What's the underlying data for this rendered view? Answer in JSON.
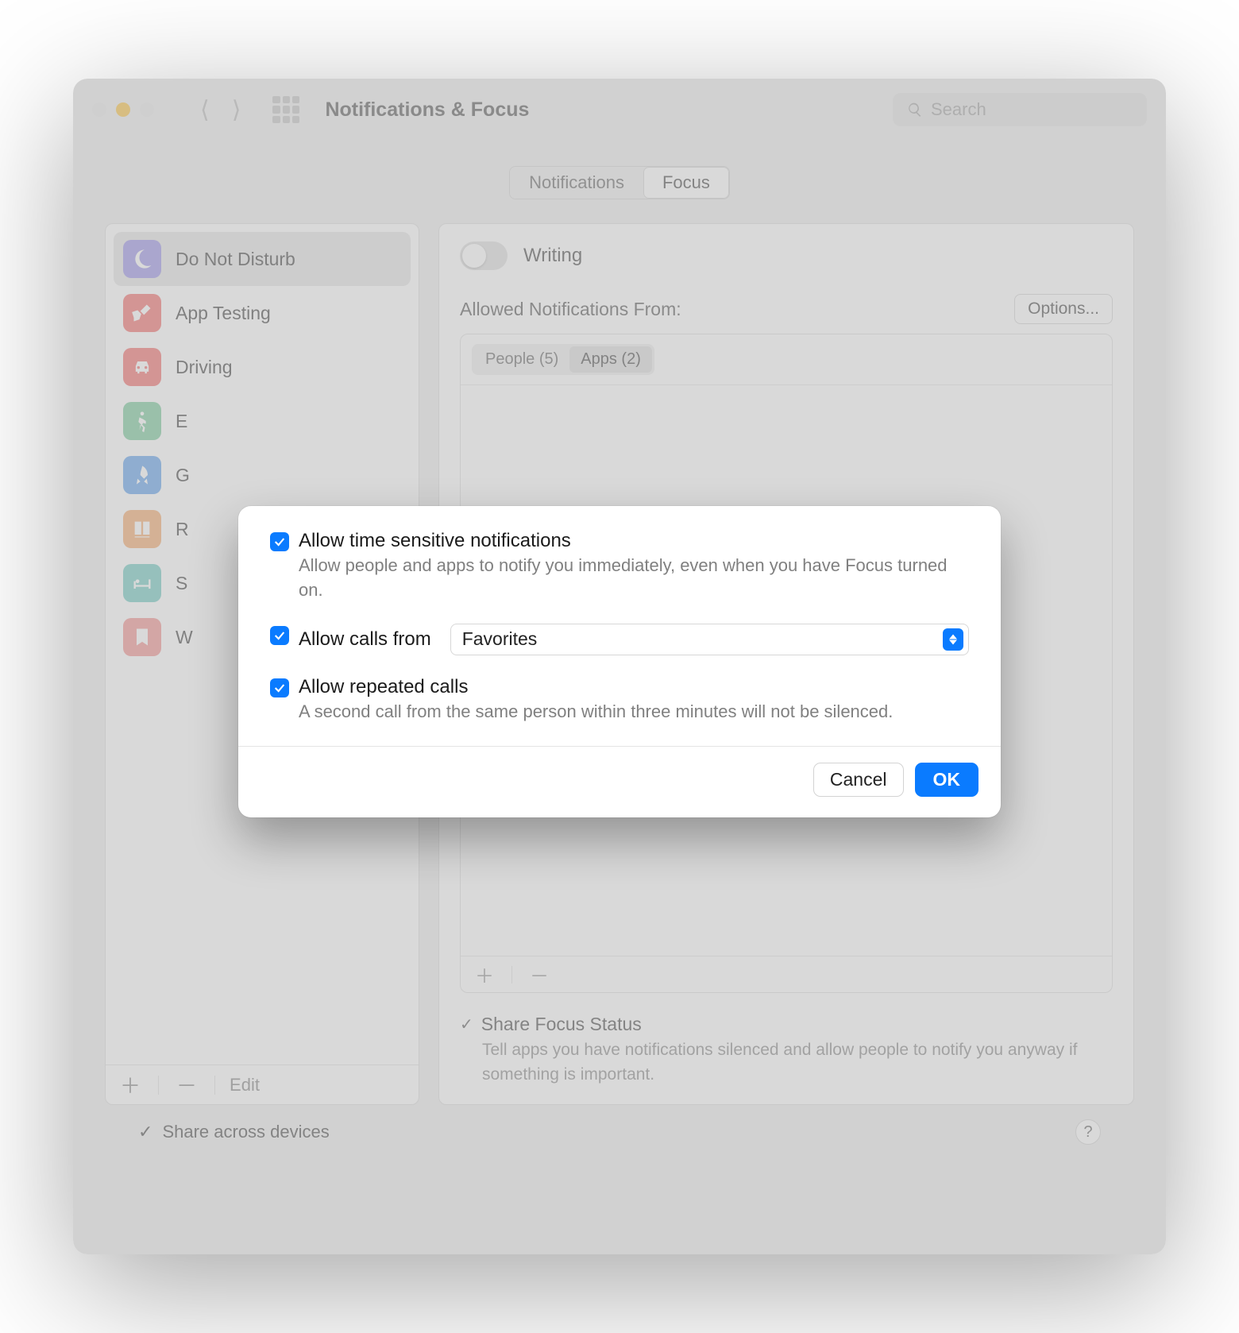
{
  "window": {
    "title": "Notifications & Focus",
    "search_placeholder": "Search"
  },
  "tabs": {
    "notifications": "Notifications",
    "focus": "Focus"
  },
  "sidebar": {
    "items": [
      {
        "label": "Do Not Disturb",
        "color": "#8f86e5",
        "icon": "moon"
      },
      {
        "label": "App Testing",
        "color": "#f05e5b",
        "icon": "tools"
      },
      {
        "label": "Driving",
        "color": "#f05e5b",
        "icon": "car"
      },
      {
        "label": "E",
        "color": "#6ac48f",
        "icon": "running"
      },
      {
        "label": "G",
        "color": "#4f97e9",
        "icon": "rocket"
      },
      {
        "label": "R",
        "color": "#f3a05e",
        "icon": "book"
      },
      {
        "label": "S",
        "color": "#61c4bb",
        "icon": "bed"
      },
      {
        "label": "W",
        "color": "#f18784",
        "icon": "bookmark"
      }
    ],
    "edit": "Edit"
  },
  "main": {
    "focus_name": "Writing",
    "allowed_label": "Allowed Notifications From:",
    "options_btn": "Options...",
    "sub_tabs": {
      "people": "People (5)",
      "apps": "Apps (2)"
    },
    "share_focus": {
      "title": "Share Focus Status",
      "desc": "Tell apps you have notifications silenced and allow people to notify you anyway if something is important."
    }
  },
  "bottom": {
    "share_across": "Share across devices"
  },
  "sheet": {
    "opt1": {
      "title": "Allow time sensitive notifications",
      "desc": "Allow people and apps to notify you immediately, even when you have Focus turned on."
    },
    "opt2": {
      "title": "Allow calls from",
      "value": "Favorites"
    },
    "opt3": {
      "title": "Allow repeated calls",
      "desc": "A second call from the same person within three minutes will not be silenced."
    },
    "cancel": "Cancel",
    "ok": "OK"
  }
}
